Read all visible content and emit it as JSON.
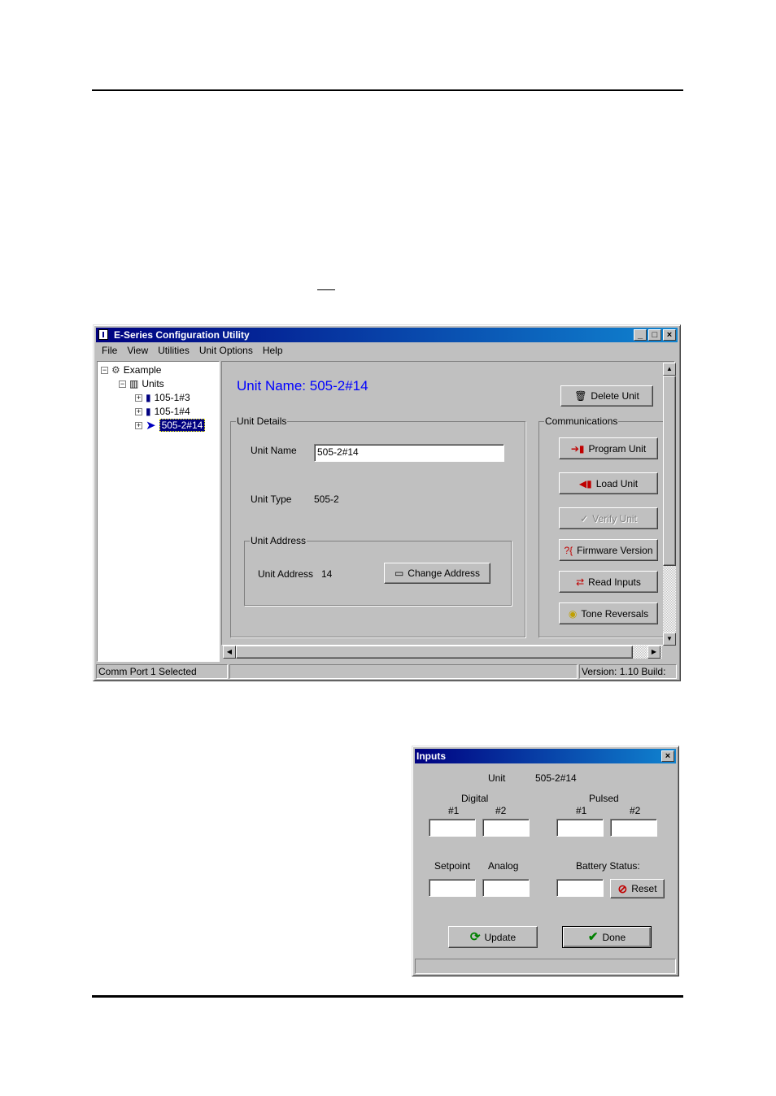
{
  "main_window": {
    "title": "E-Series Configuration Utility",
    "controls": {
      "minimize": "_",
      "maximize": "□",
      "close": "×"
    },
    "menu": [
      "File",
      "View",
      "Utilities",
      "Unit Options",
      "Help"
    ],
    "tree": {
      "root": "Example",
      "units_label": "Units",
      "items": [
        "105-1#3",
        "105-1#4",
        "505-2#14"
      ],
      "selected": "505-2#14"
    },
    "unit_name_heading": "Unit Name: 505-2#14",
    "unit_details": {
      "group_label": "Unit Details",
      "name_label": "Unit Name",
      "name_value": "505-2#14",
      "type_label": "Unit Type",
      "type_value": "505-2",
      "address_group_label": "Unit Address",
      "address_label": "Unit Address",
      "address_value": "14",
      "change_address_button": "Change Address"
    },
    "delete_unit_button": "Delete Unit",
    "communications": {
      "group_label": "Communications",
      "program_unit": "Program Unit",
      "load_unit": "Load Unit",
      "verify_unit": "Verify Unit",
      "firmware_version": "Firmware Version",
      "read_inputs": "Read Inputs",
      "tone_reversals": "Tone Reversals"
    },
    "status_bar": {
      "left": "Comm Port 1 Selected",
      "middle": "",
      "right": "Version: 1.10 Build:"
    },
    "colors": {
      "heading": "#0000ff",
      "title_start": "#000080",
      "title_end": "#1084d0"
    }
  },
  "inputs_dialog": {
    "title": "Inputs",
    "close": "×",
    "unit_label": "Unit",
    "unit_value": "505-2#14",
    "digital_label": "Digital",
    "pulsed_label": "Pulsed",
    "num1": "#1",
    "num2": "#2",
    "setpoint_label": "Setpoint",
    "analog_label": "Analog",
    "battery_label": "Battery Status:",
    "reset_button": "Reset",
    "update_button": "Update",
    "done_button": "Done",
    "status": ""
  }
}
